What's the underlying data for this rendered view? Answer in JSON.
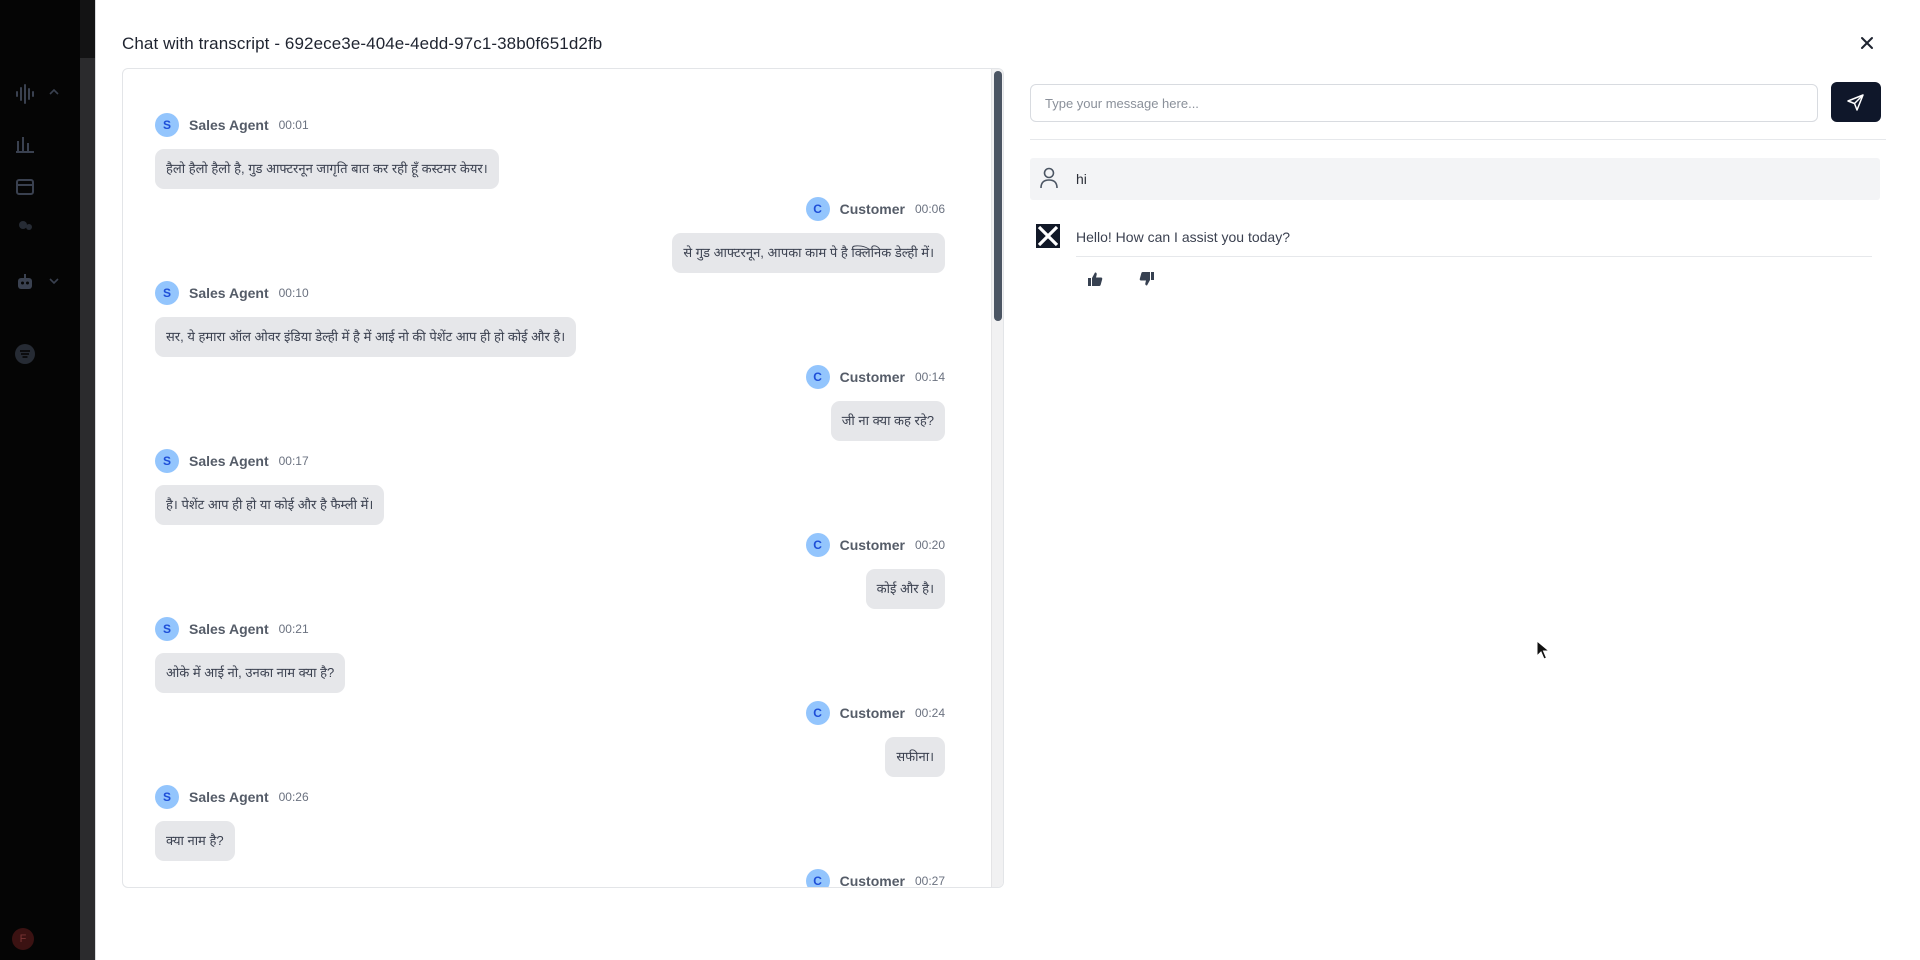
{
  "modal": {
    "title": "Chat with transcript - 692ece3e-404e-4edd-97c1-38b0f651d2fb"
  },
  "transcript": {
    "messages": [
      {
        "role": "agent",
        "initial": "S",
        "speaker": "Sales Agent",
        "time": "00:01",
        "text": "हैलो हैलो हैलो है, गुड आफ्टरनून जागृति बात कर रही हूँ कस्टमर केयर।"
      },
      {
        "role": "customer",
        "initial": "C",
        "speaker": "Customer",
        "time": "00:06",
        "text": "से गुड आफ्टरनून, आपका काम पे है क्लिनिक डेल्ही में।"
      },
      {
        "role": "agent",
        "initial": "S",
        "speaker": "Sales Agent",
        "time": "00:10",
        "text": "सर, ये हमारा ऑल ओवर इंडिया डेल्ही में है में आई नो की पेशेंट आप ही हो कोई और है।"
      },
      {
        "role": "customer",
        "initial": "C",
        "speaker": "Customer",
        "time": "00:14",
        "text": "जी ना क्या कह रहे?"
      },
      {
        "role": "agent",
        "initial": "S",
        "speaker": "Sales Agent",
        "time": "00:17",
        "text": "है। पेशेंट आप ही हो या कोई और है फैम्ली में।"
      },
      {
        "role": "customer",
        "initial": "C",
        "speaker": "Customer",
        "time": "00:20",
        "text": "कोई और है।"
      },
      {
        "role": "agent",
        "initial": "S",
        "speaker": "Sales Agent",
        "time": "00:21",
        "text": "ओके में आई नो, उनका नाम क्या है?"
      },
      {
        "role": "customer",
        "initial": "C",
        "speaker": "Customer",
        "time": "00:24",
        "text": "सफीना।"
      },
      {
        "role": "agent",
        "initial": "S",
        "speaker": "Sales Agent",
        "time": "00:26",
        "text": "क्या नाम है?"
      },
      {
        "role": "customer",
        "initial": "C",
        "speaker": "Customer",
        "time": "00:27",
        "text": ""
      }
    ]
  },
  "chat": {
    "input_placeholder": "Type your message here...",
    "user_message": "hi",
    "bot_message": "Hello! How can I assist you today?"
  },
  "sidebar": {
    "avatar_initial": "F"
  },
  "colors": {
    "accent": "#0f172a",
    "avatar_bg": "#93c5fd",
    "avatar_text": "#1d4ed8",
    "bubble_bg": "#e6e7ea"
  }
}
